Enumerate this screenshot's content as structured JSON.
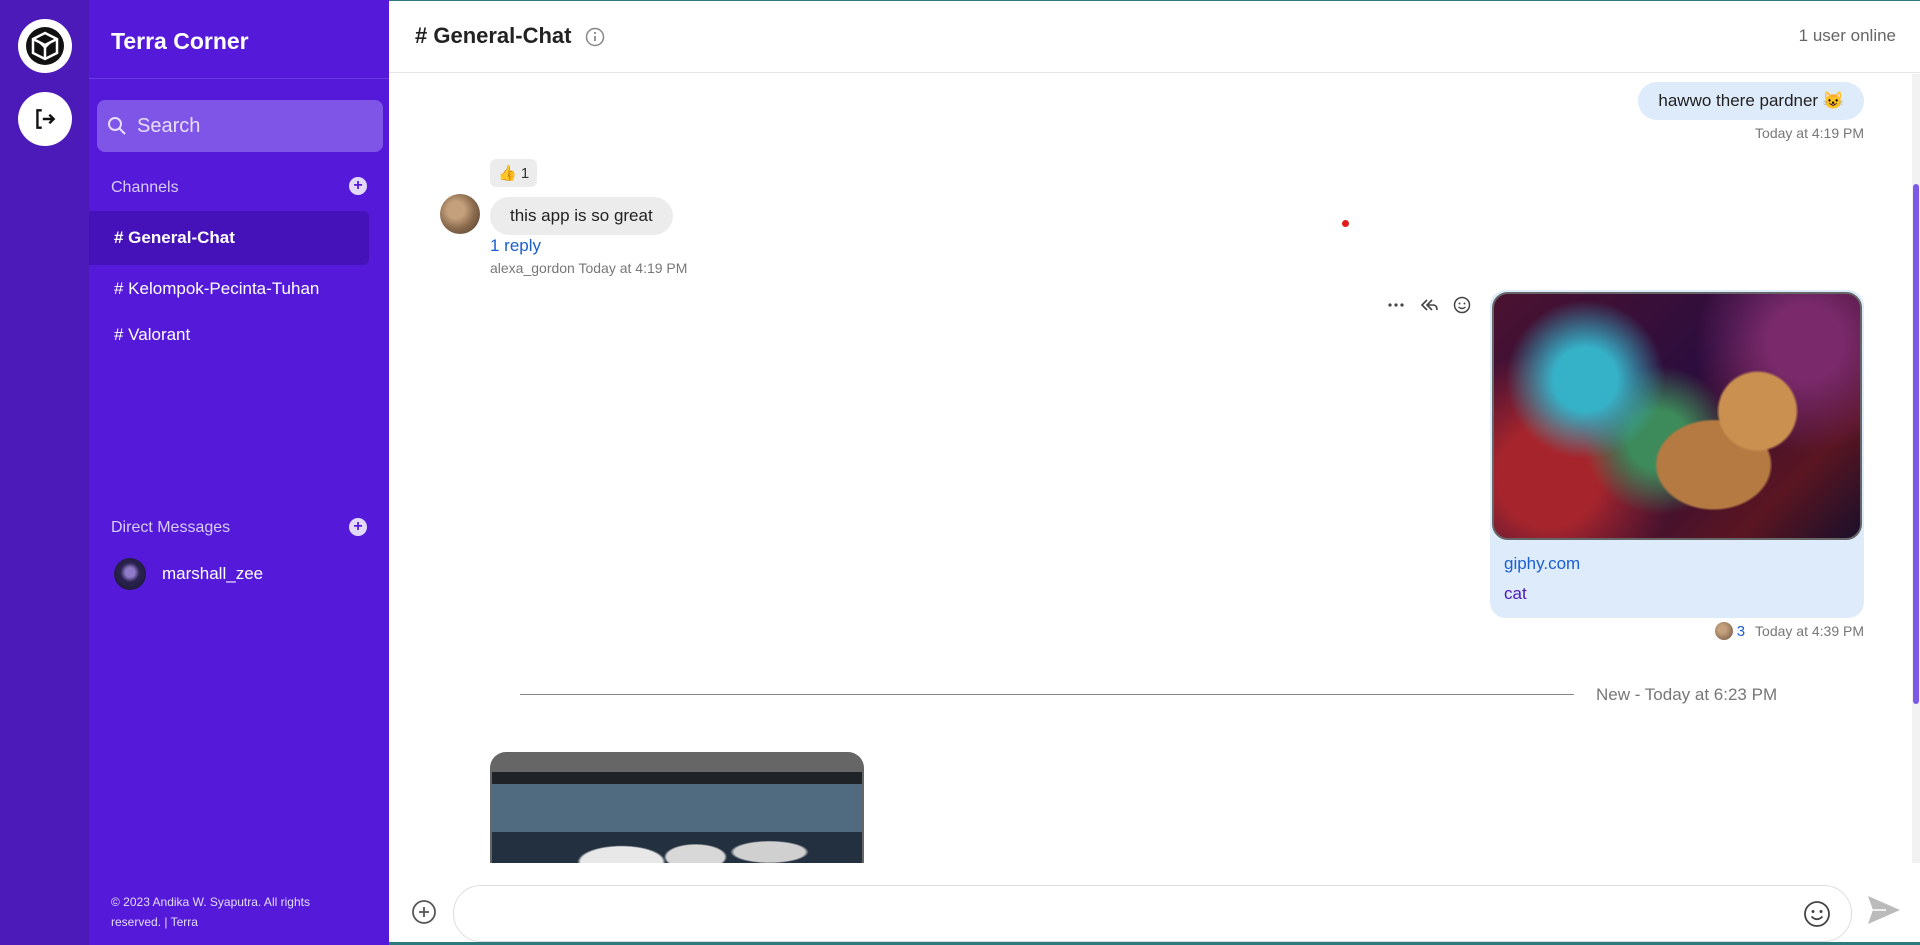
{
  "sidebar": {
    "workspace_title": "Terra Corner",
    "search_placeholder": "Search",
    "channels_heading": "Channels",
    "channels": [
      "# General-Chat",
      "# Kelompok-Pecinta-Tuhan",
      "# Valorant"
    ],
    "dm_heading": "Direct Messages",
    "dms": [
      "marshall_zee"
    ],
    "footer": "© 2023 Andika W. Syaputra. All rights reserved. | Terra"
  },
  "header": {
    "channel_title": "# General-Chat",
    "online": "1 user online"
  },
  "messages": {
    "m1_text": "hawwo there pardner 😺",
    "m1_time": "Today at 4:19 PM",
    "m2_reaction": "👍 1",
    "m2_text": "this app is so great",
    "m2_reply": "1 reply",
    "m2_meta": "alexa_gordon Today at 4:19 PM",
    "m3_link": "giphy.com",
    "m3_desc": "cat",
    "m3_count": "3",
    "m3_time": "Today at 4:39 PM",
    "new_label": "New - Today at 6:23 PM"
  },
  "colors": {
    "rail": "#4b1ab8",
    "sidebar": "#5419d9",
    "accent": "#7c5ae3",
    "link": "#1a5fd0",
    "bubble_out": "#deebfb",
    "bubble_in": "#ececec"
  }
}
